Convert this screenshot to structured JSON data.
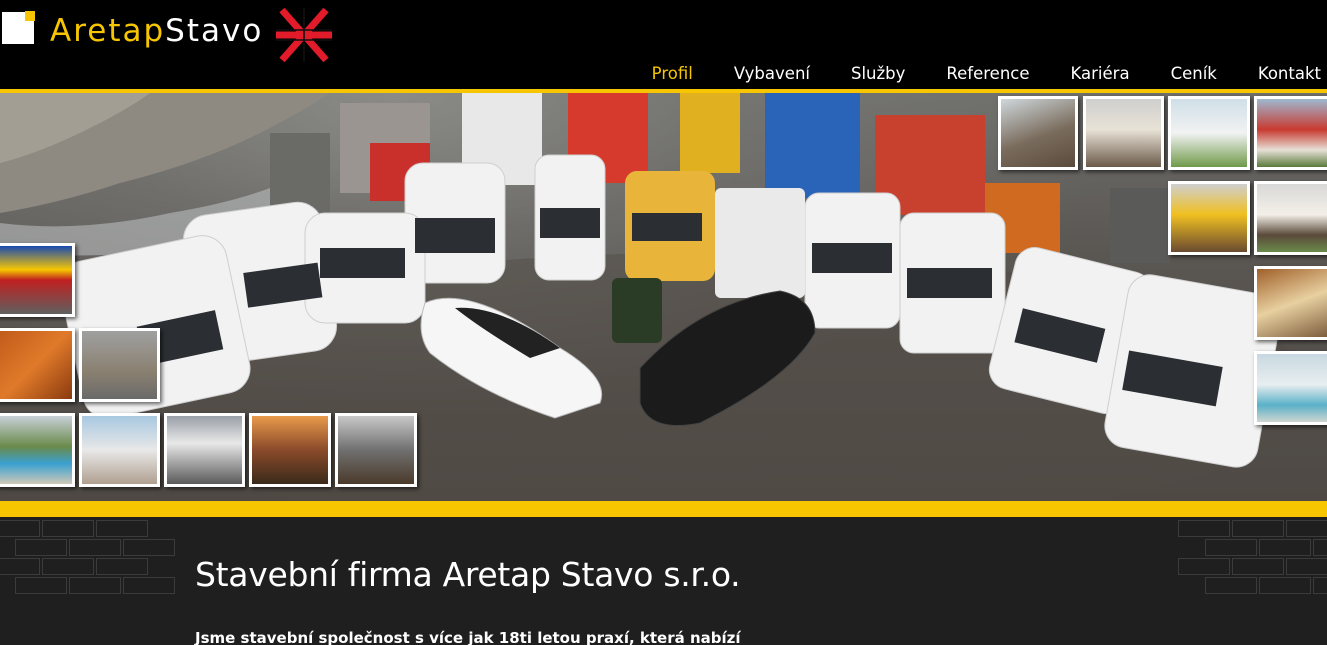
{
  "brand": {
    "part1": "Aretap",
    "part2": "Stavo"
  },
  "nav": {
    "items": [
      {
        "label": "Profil",
        "active": true
      },
      {
        "label": "Vybavení",
        "active": false
      },
      {
        "label": "Služby",
        "active": false
      },
      {
        "label": "Reference",
        "active": false
      },
      {
        "label": "Kariéra",
        "active": false
      },
      {
        "label": "Ceník",
        "active": false
      },
      {
        "label": "Kontakt",
        "active": false
      }
    ]
  },
  "colors": {
    "accent": "#f7c600",
    "header_bg": "#000000",
    "content_bg": "#1f1f1f",
    "logo_red": "#e21b2a"
  },
  "main": {
    "title": "Stavební firma Aretap Stavo s.r.o.",
    "lead": "Jsme stavební společnost s více jak 18ti letou praxí, která nabízí"
  }
}
